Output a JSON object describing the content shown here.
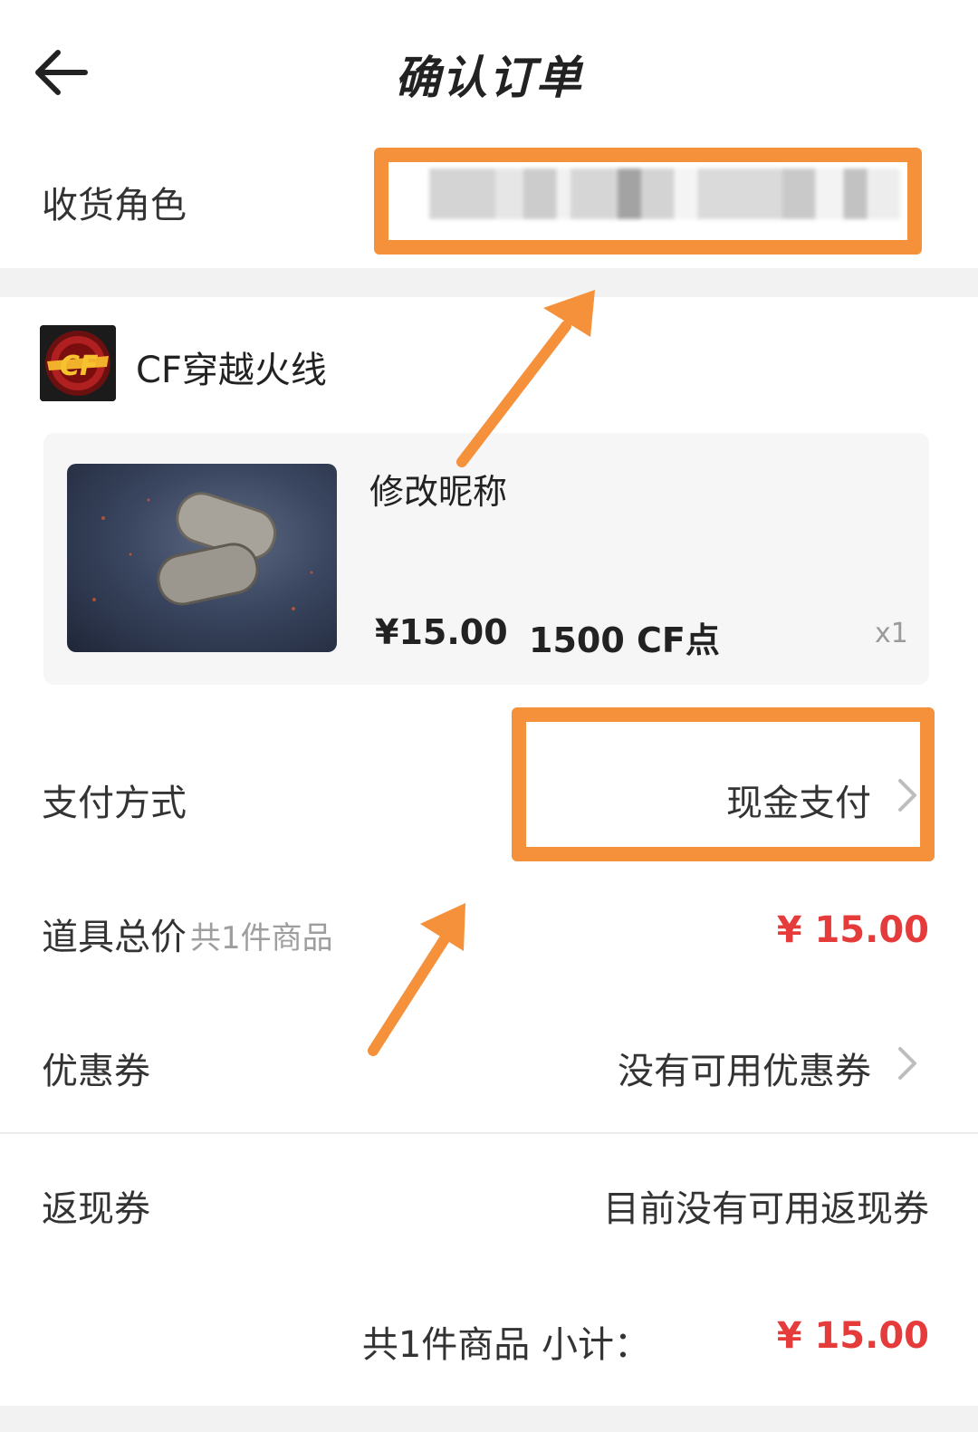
{
  "header": {
    "title": "确认订单",
    "back_icon": "arrow-left-icon"
  },
  "receiver": {
    "label": "收货角色"
  },
  "game": {
    "name": "CF穿越火线",
    "logo_icon": "cf-game-logo-icon"
  },
  "product": {
    "name": "修改昵称",
    "price": "¥15.00",
    "points": "1500 CF点",
    "quantity": "x1"
  },
  "payment": {
    "label": "支付方式",
    "value": "现金支付"
  },
  "total": {
    "label": "道具总价",
    "sub": "共1件商品",
    "value": "¥ 15.00"
  },
  "coupon": {
    "label": "优惠券",
    "value": "没有可用优惠券"
  },
  "cashback": {
    "label": "返现券",
    "value": "目前没有可用返现券"
  },
  "summary": {
    "text": "共1件商品 小计：",
    "value": "¥ 15.00"
  },
  "colors": {
    "accent_orange": "#f5903b",
    "price_red": "#e63b3b"
  }
}
